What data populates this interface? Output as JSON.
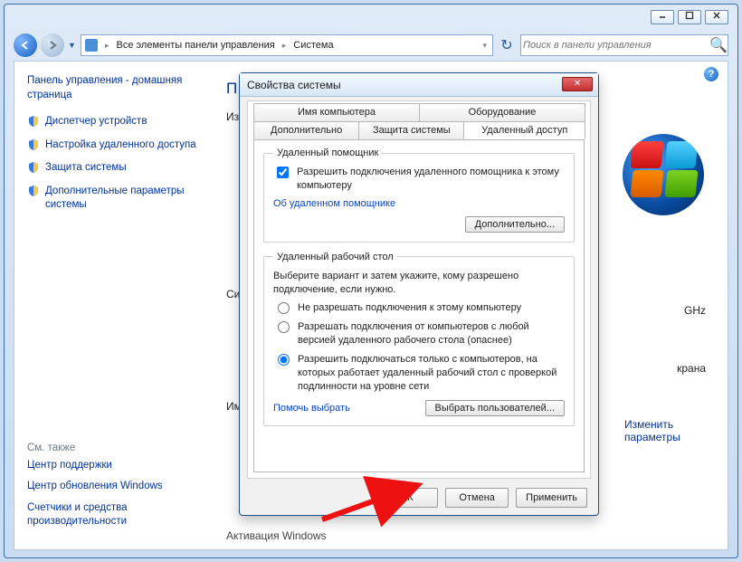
{
  "toolbar": {
    "breadcrumb_root": "Все элементы панели управления",
    "breadcrumb_leaf": "Система",
    "search_placeholder": "Поиск в панели управления"
  },
  "sidebar": {
    "home": "Панель управления - домашняя страница",
    "links": [
      "Диспетчер устройств",
      "Настройка удаленного доступа",
      "Защита системы",
      "Дополнительные параметры системы"
    ],
    "see_also_header": "См. также",
    "see_also": [
      "Центр поддержки",
      "Центр обновления Windows",
      "Счетчики и средства производительности"
    ]
  },
  "main": {
    "heading_cut": "П",
    "row1": "Из",
    "row2": "Си",
    "row3": "Им",
    "ghz": "GHz",
    "krана": "крана",
    "change_link": "Изменить параметры",
    "activation": "Активация Windows"
  },
  "dialog": {
    "title": "Свойства системы",
    "tabs_back": [
      "Имя компьютера",
      "Оборудование"
    ],
    "tabs_front": [
      "Дополнительно",
      "Защита системы",
      "Удаленный доступ"
    ],
    "group_assistant": {
      "legend": "Удаленный помощник",
      "checkbox": "Разрешить подключения удаленного помощника к этому компьютеру",
      "about_link": "Об удаленном помощнике",
      "advanced_btn": "Дополнительно..."
    },
    "group_rdp": {
      "legend": "Удаленный рабочий стол",
      "instr": "Выберите вариант и затем укажите, кому разрешено подключение, если нужно.",
      "opt1": "Не разрешать подключения к этому компьютеру",
      "opt2": "Разрешать подключения от компьютеров с любой версией удаленного рабочего стола (опаснее)",
      "opt3": "Разрешить подключаться только с компьютеров, на которых работает удаленный рабочий стол с проверкой подлинности на уровне сети",
      "help_link": "Помочь выбрать",
      "select_users_btn": "Выбрать пользователей..."
    },
    "footer": {
      "ok": "ОК",
      "cancel": "Отмена",
      "apply": "Применить"
    }
  }
}
